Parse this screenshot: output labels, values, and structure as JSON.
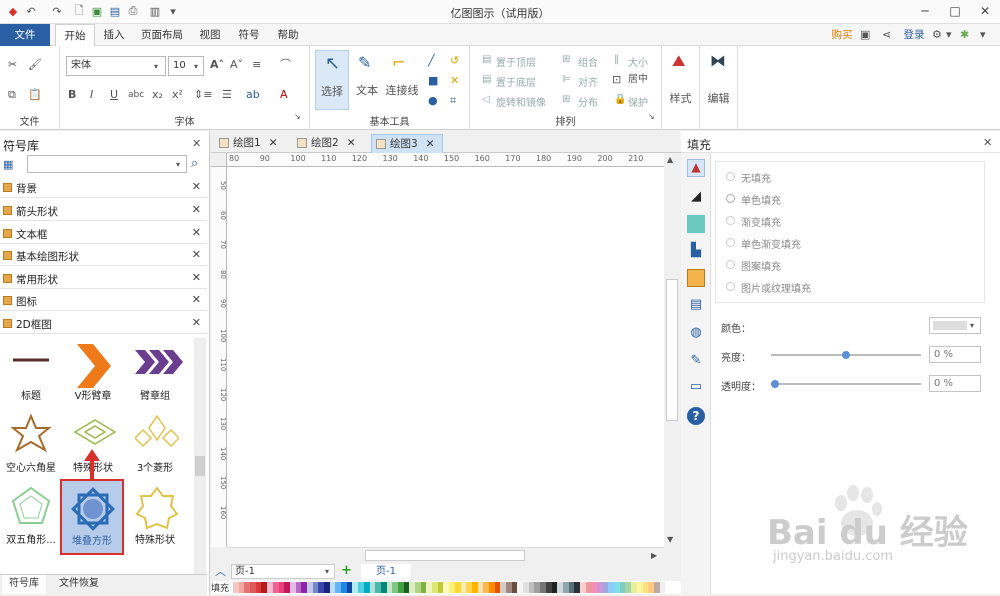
{
  "window": {
    "title": "亿图图示（试用版）"
  },
  "menu": {
    "file": "文件",
    "tabs": [
      "开始",
      "插入",
      "页面布局",
      "视图",
      "符号",
      "帮助"
    ],
    "right": {
      "buy": "购买",
      "login": "登录"
    }
  },
  "ribbon": {
    "groups": {
      "file": "文件",
      "font": "字体",
      "basic_tools": "基本工具",
      "arrange": "排列"
    },
    "font_name": "宋体",
    "font_size": "10",
    "tools": {
      "select": "选择",
      "text": "文本",
      "connector": "连接线"
    },
    "arrange": {
      "to_top": "置于顶层",
      "to_bottom": "置于底层",
      "rotate": "旋转和镜像",
      "group": "组合",
      "align": "对齐",
      "distribute": "分布",
      "size": "大小",
      "center": "居中",
      "protect": "保护"
    },
    "style": "样式",
    "edit": "编辑"
  },
  "library": {
    "title": "符号库",
    "categories": [
      "背景",
      "箭头形状",
      "文本框",
      "基本绘图形状",
      "常用形状",
      "图标",
      "2D框图"
    ],
    "shapes": [
      "标题",
      "V形臂章",
      "臂章组",
      "空心六角星",
      "特殊形状",
      "3个菱形",
      "双五角形...",
      "堆叠方形",
      "特殊形状"
    ],
    "bottom_tabs": [
      "符号库",
      "文件恢复"
    ]
  },
  "documents": {
    "tabs": [
      "绘图1",
      "绘图2",
      "绘图3"
    ],
    "ruler_h": [
      "80",
      "90",
      "100",
      "110",
      "120",
      "130",
      "140",
      "150",
      "160",
      "170",
      "180",
      "190",
      "200",
      "210"
    ],
    "ruler_v": [
      "50",
      "60",
      "70",
      "80",
      "90",
      "100",
      "110",
      "120",
      "130",
      "140",
      "150",
      "160"
    ]
  },
  "pagebar": {
    "page_select": "页-1",
    "page_tab": "页-1",
    "fill_label": "填充"
  },
  "fill_panel": {
    "title": "填充",
    "options": [
      "无填充",
      "单色填充",
      "渐变填充",
      "单色渐变填充",
      "图案填充",
      "图片或纹理填充"
    ],
    "color_label": "颜色：",
    "brightness_label": "亮度：",
    "brightness_value": "0 %",
    "transparency_label": "透明度：",
    "transparency_value": "0 %"
  },
  "watermark": {
    "brand": "Bai du 经验",
    "url": "jingyan.baidu.com"
  },
  "colors": {
    "file_tab": "#2b5fa3",
    "accent": "#2b5fa3",
    "highlight": "#d9302c"
  }
}
